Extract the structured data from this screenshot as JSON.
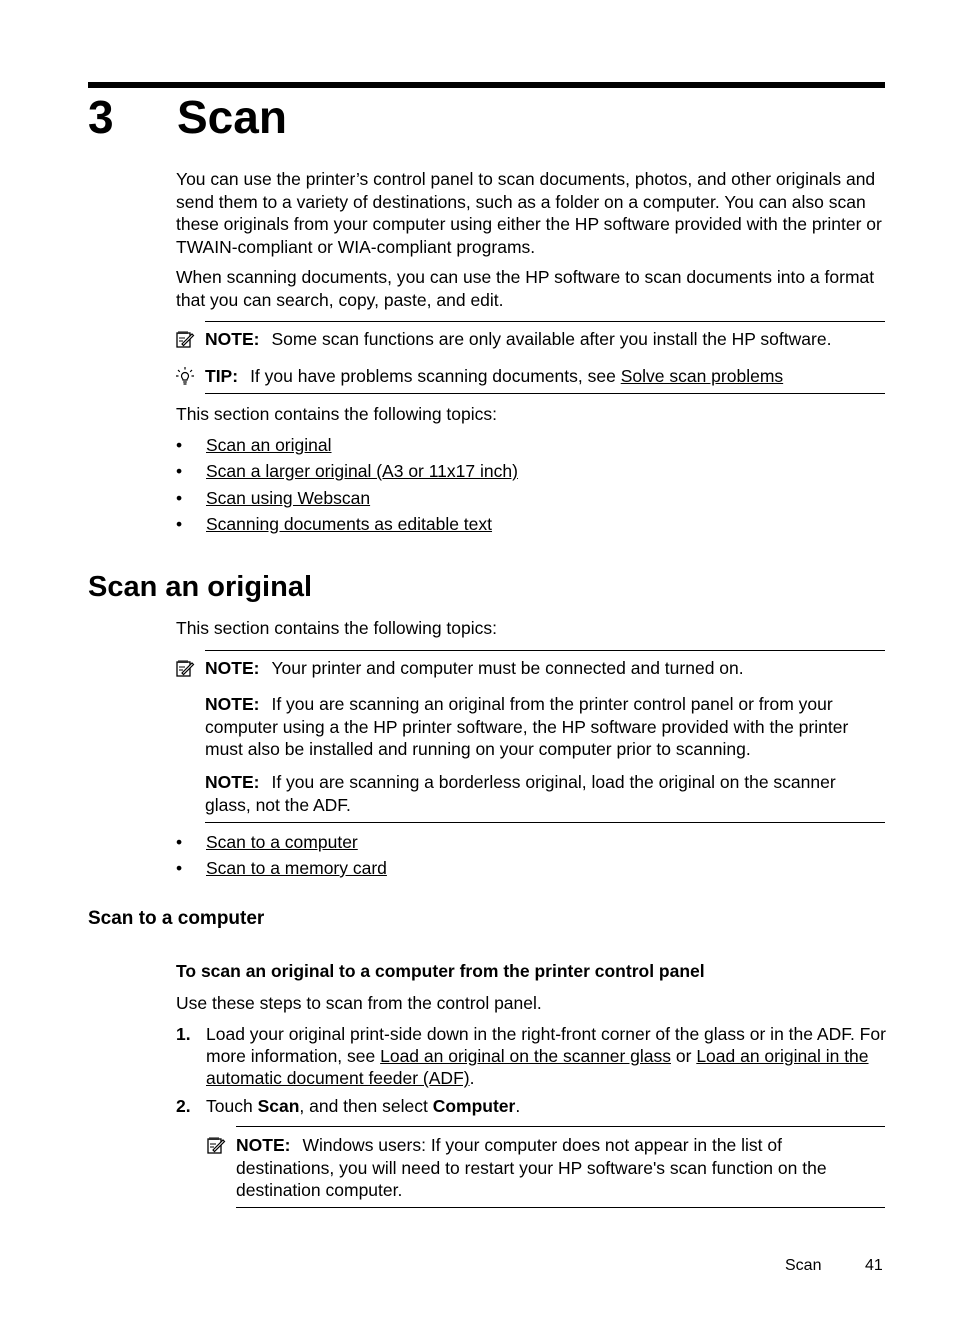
{
  "chapter": {
    "number": "3",
    "title": "Scan"
  },
  "intro": {
    "p1": "You can use the printer’s control panel to scan documents, photos, and other originals and send them to a variety of destinations, such as a folder on a computer. You can also scan these originals from your computer using either the HP software provided with the printer or TWAIN-compliant or WIA-compliant programs.",
    "p2": "When scanning documents, you can use the HP software to scan documents into a format that you can search, copy, paste, and edit.",
    "note": {
      "label": "NOTE:",
      "text": "Some scan functions are only available after you install the HP software."
    },
    "tip": {
      "label": "TIP:",
      "text": "If you have problems scanning documents, see ",
      "link": "Solve scan problems"
    },
    "topics_intro": "This section contains the following topics:",
    "topics": [
      "Scan an original",
      "Scan a larger original (A3 or 11x17 inch)",
      "Scan using Webscan",
      "Scanning documents as editable text"
    ]
  },
  "scan_original": {
    "heading": "Scan an original",
    "topics_intro": "This section contains the following topics:",
    "notes": [
      {
        "label": "NOTE:",
        "text": "Your printer and computer must be connected and turned on."
      },
      {
        "label": "NOTE:",
        "text": "If you are scanning an original from the printer control panel or from your computer using a the HP printer software, the HP software provided with the printer must also be installed and running on your computer prior to scanning."
      },
      {
        "label": "NOTE:",
        "text": "If you are scanning a borderless original, load the original on the scanner glass, not the ADF."
      }
    ],
    "topics": [
      "Scan to a computer",
      "Scan to a memory card"
    ]
  },
  "scan_to_computer": {
    "heading": "Scan to a computer",
    "subheading": "To scan an original to a computer from the printer control panel",
    "intro": "Use these steps to scan from the control panel.",
    "steps": [
      {
        "num": "1.",
        "text_a": "Load your original print-side down in the right-front corner of the glass or in the ADF. For more information, see ",
        "link1": "Load an original on the scanner glass",
        "text_b": " or ",
        "link2": "Load an original in the automatic document feeder (ADF)",
        "text_c": "."
      },
      {
        "num": "2.",
        "text_a": "Touch ",
        "bold1": "Scan",
        "text_b": ", and then select ",
        "bold2": "Computer",
        "text_c": "."
      }
    ],
    "note": {
      "label": "NOTE:",
      "text": "Windows users: If your computer does not appear in the list of destinations, you will need to restart your HP software's scan function on the destination computer."
    }
  },
  "footer": {
    "section": "Scan",
    "page": "41"
  }
}
